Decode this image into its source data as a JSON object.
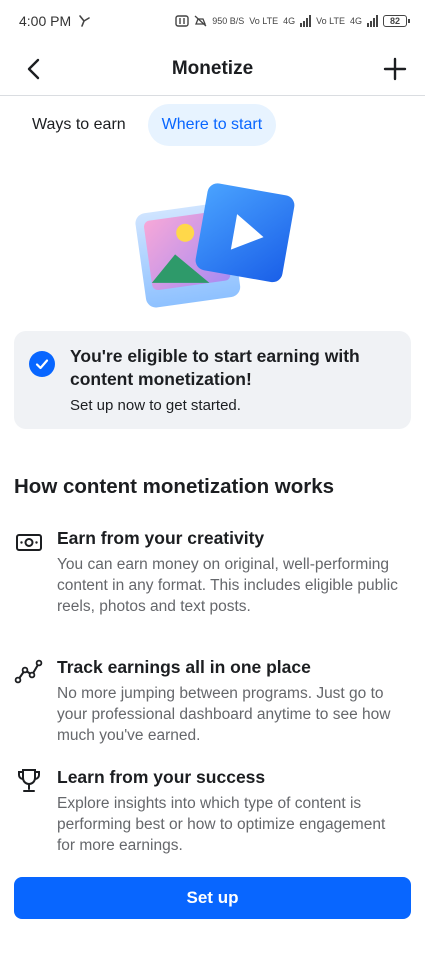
{
  "status_bar": {
    "time": "4:00 PM",
    "net_speed": "950 B/S",
    "net1": "Vo LTE",
    "net1b": "4G",
    "net2": "Vo LTE",
    "net2b": "4G",
    "battery": "82"
  },
  "header": {
    "title": "Monetize",
    "back_icon": "chevron-left-icon",
    "add_icon": "plus-icon"
  },
  "tabs": [
    {
      "label": "Ways to earn",
      "active": false
    },
    {
      "label": "Where to start",
      "active": true
    }
  ],
  "eligibility": {
    "heading": "You're eligible to start earning with content monetization!",
    "subtext": "Set up now to get started.",
    "icon": "check-circle-icon"
  },
  "section_title": "How content monetization works",
  "features": [
    {
      "icon": "money-icon",
      "title": "Earn from your creativity",
      "description": "You can earn money on original, well-performing content in any format. This includes eligible public reels, photos and text posts."
    },
    {
      "icon": "trend-line-icon",
      "title": "Track earnings all in one place",
      "description": "No more jumping between programs. Just go to your professional dashboard anytime to see how much you've earned."
    },
    {
      "icon": "trophy-icon",
      "title": "Learn from your success",
      "description": "Explore insights into which type of content is performing best or how to optimize engagement for more earnings."
    }
  ],
  "cta": {
    "label": "Set up"
  },
  "colors": {
    "accent": "#0866ff",
    "tab_active_bg": "#e7f3ff",
    "card_bg": "#f0f2f5",
    "secondary_text": "#65676b"
  }
}
